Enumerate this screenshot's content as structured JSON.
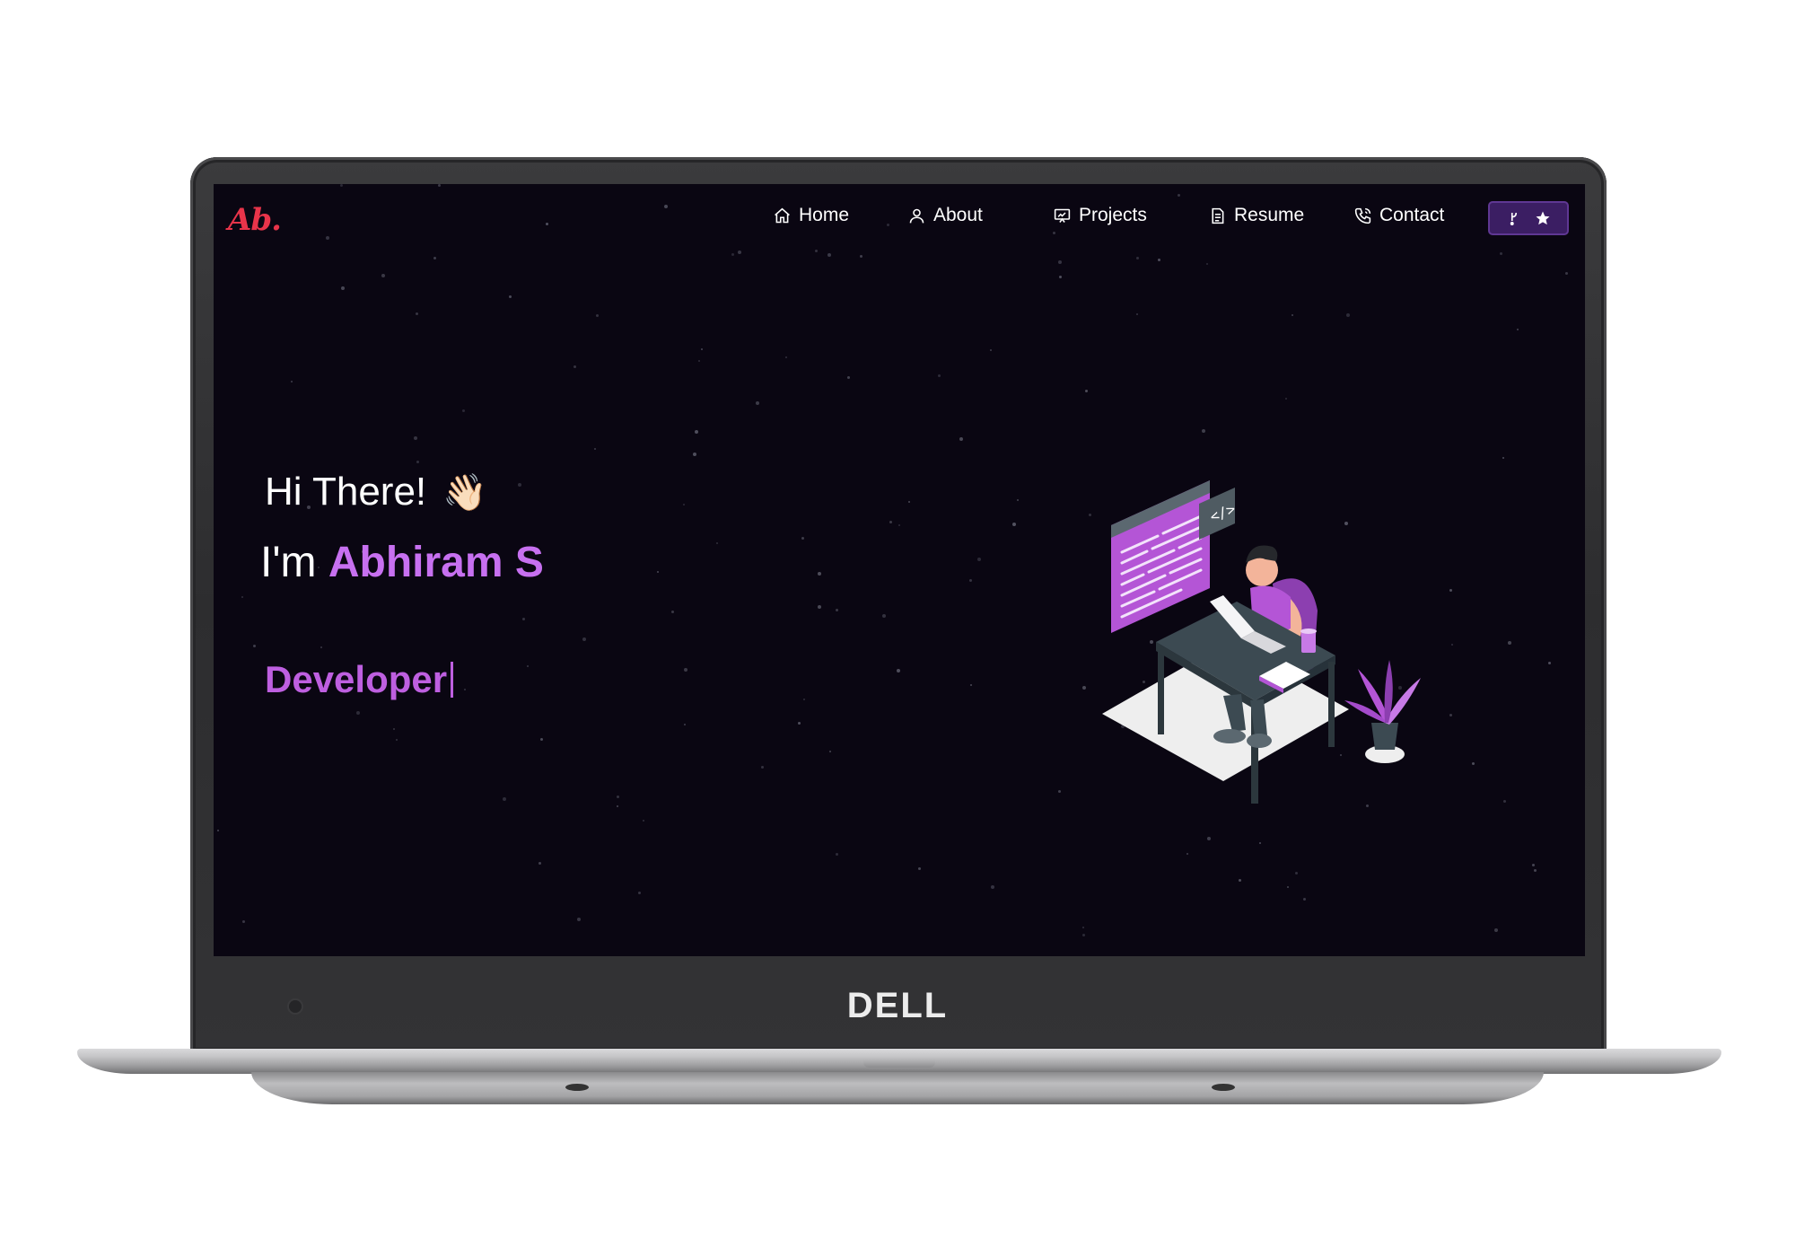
{
  "brand": {
    "logo_text": "Ab.",
    "logo_color": "#e8344a",
    "device_label": "DELL"
  },
  "nav": {
    "items": [
      {
        "label": "Home",
        "icon": "home-icon"
      },
      {
        "label": "About",
        "icon": "user-icon"
      },
      {
        "label": "Projects",
        "icon": "presentation-icon"
      },
      {
        "label": "Resume",
        "icon": "document-icon"
      },
      {
        "label": "Contact",
        "icon": "phone-icon"
      }
    ],
    "github_button": {
      "icons": [
        "git-fork-icon",
        "star-icon"
      ],
      "bg": "#3b1e63"
    }
  },
  "hero": {
    "greeting": "Hi There!",
    "greeting_emoji": "👋🏻",
    "intro_prefix": "I'm",
    "name": "Abhiram S",
    "role": "Developer",
    "accent": "#c770f0"
  },
  "illustration": {
    "icon": "developer-at-desk-illustration",
    "code_badge": "</>"
  }
}
